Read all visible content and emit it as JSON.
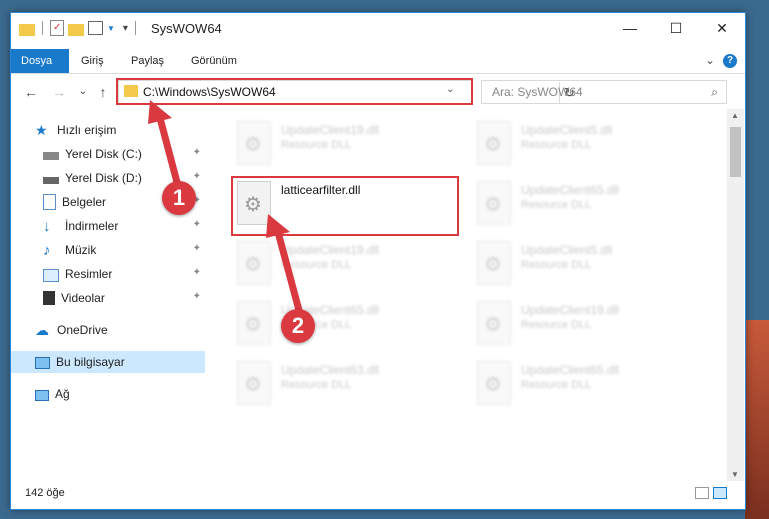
{
  "title": "SysWOW64",
  "window_buttons": {
    "minimize": "—",
    "maximize": "☐",
    "close": "✕"
  },
  "ribbon": {
    "tabs": [
      {
        "label": "Dosya",
        "active": true
      },
      {
        "label": "Giriş",
        "active": false
      },
      {
        "label": "Paylaş",
        "active": false
      },
      {
        "label": "Görünüm",
        "active": false
      }
    ],
    "expand": "⌄",
    "help": "?"
  },
  "nav": {
    "back": "←",
    "forward": "→",
    "recent": "⌄",
    "up": "↑"
  },
  "address": {
    "path": "C:\\Windows\\SysWOW64",
    "dropdown": "⌄",
    "refresh": "↻"
  },
  "search": {
    "placeholder": "Ara: SysWOW64",
    "icon": "⌕"
  },
  "sidebar": {
    "items": [
      {
        "label": "Hızlı erişim",
        "icon": "star-icon",
        "pinned": false
      },
      {
        "label": "Yerel Disk (C:)",
        "icon": "drive-icon",
        "pinned": true
      },
      {
        "label": "Yerel Disk (D:)",
        "icon": "drive-icon",
        "pinned": true
      },
      {
        "label": "Belgeler",
        "icon": "documents-icon",
        "pinned": true
      },
      {
        "label": "İndirmeler",
        "icon": "download-icon",
        "pinned": true
      },
      {
        "label": "Müzik",
        "icon": "music-icon",
        "pinned": true
      },
      {
        "label": "Resimler",
        "icon": "pictures-icon",
        "pinned": true
      },
      {
        "label": "Videolar",
        "icon": "videos-icon",
        "pinned": true
      },
      {
        "label": "OneDrive",
        "icon": "cloud-icon",
        "pinned": false
      },
      {
        "label": "Bu bilgisayar",
        "icon": "computer-icon",
        "pinned": false,
        "selected": true
      },
      {
        "label": "Ağ",
        "icon": "network-icon",
        "pinned": false
      }
    ],
    "pin_glyph": "📌"
  },
  "files": [
    {
      "name": "UpdateClient19.dll",
      "desc": "Resource DLL",
      "highlight": false
    },
    {
      "name": "UpdateClient5.dll",
      "desc": "Resource DLL",
      "highlight": false
    },
    {
      "name": "latticearfilter.dll",
      "desc": "",
      "highlight": true
    },
    {
      "name": "UpdateClient65.dll",
      "desc": "Resource DLL",
      "highlight": false
    },
    {
      "name": "UpdateClient19.dll",
      "desc": "Resource DLL",
      "highlight": false
    },
    {
      "name": "UpdateClient5.dll",
      "desc": "Resource DLL",
      "highlight": false
    },
    {
      "name": "UpdateClient65.dll",
      "desc": "Resource DLL",
      "highlight": false
    },
    {
      "name": "UpdateClient19.dll",
      "desc": "Resource DLL",
      "highlight": false
    },
    {
      "name": "UpdateClient63.dll",
      "desc": "Resource DLL",
      "highlight": false
    },
    {
      "name": "UpdateClient65.dll",
      "desc": "Resource DLL",
      "highlight": false
    }
  ],
  "status": {
    "count": "142 öğe"
  },
  "callouts": {
    "one": "1",
    "two": "2"
  },
  "colors": {
    "accent": "#1979ca",
    "callout": "#d9393f",
    "selected": "#cce8ff"
  }
}
